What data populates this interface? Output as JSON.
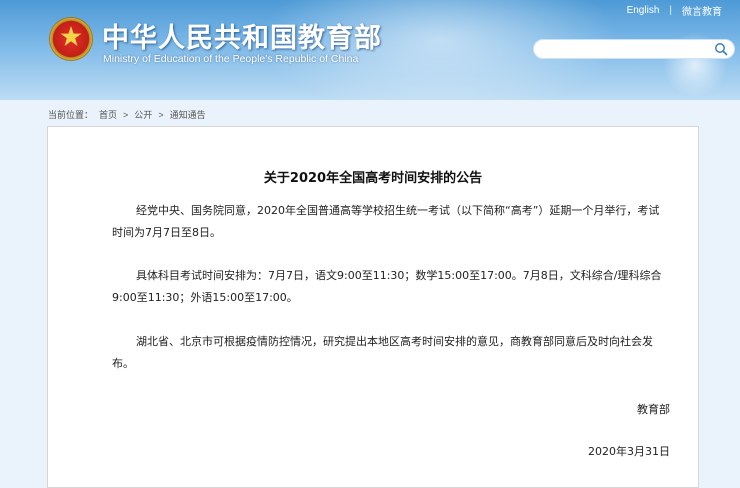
{
  "header": {
    "site_title": "中华人民共和国教育部",
    "site_subtitle": "Ministry of Education of the People's Republic of China",
    "links": {
      "english": "English",
      "weibo": "微言教育"
    },
    "search": {
      "value": "",
      "placeholder": ""
    }
  },
  "breadcrumb": {
    "prefix": "当前位置：",
    "items": [
      "首页",
      "公开",
      "通知通告"
    ],
    "separator": ">"
  },
  "article": {
    "title": "关于2020年全国高考时间安排的公告",
    "paragraphs": [
      "经党中央、国务院同意，2020年全国普通高等学校招生统一考试（以下简称“高考”）延期一个月举行，考试时间为7月7日至8日。",
      "具体科目考试时间安排为：7月7日，语文9:00至11:30；数学15:00至17:00。7月8日，文科综合/理科综合9:00至11:30；外语15:00至17:00。",
      "湖北省、北京市可根据疫情防控情况，研究提出本地区高考时间安排的意见，商教育部同意后及时向社会发布。"
    ],
    "signer": "教育部",
    "date": "2020年3月31日"
  },
  "colors": {
    "header_blue": "#4d9ad6",
    "emblem_red": "#c21f16",
    "emblem_gold": "#e8c04a"
  }
}
